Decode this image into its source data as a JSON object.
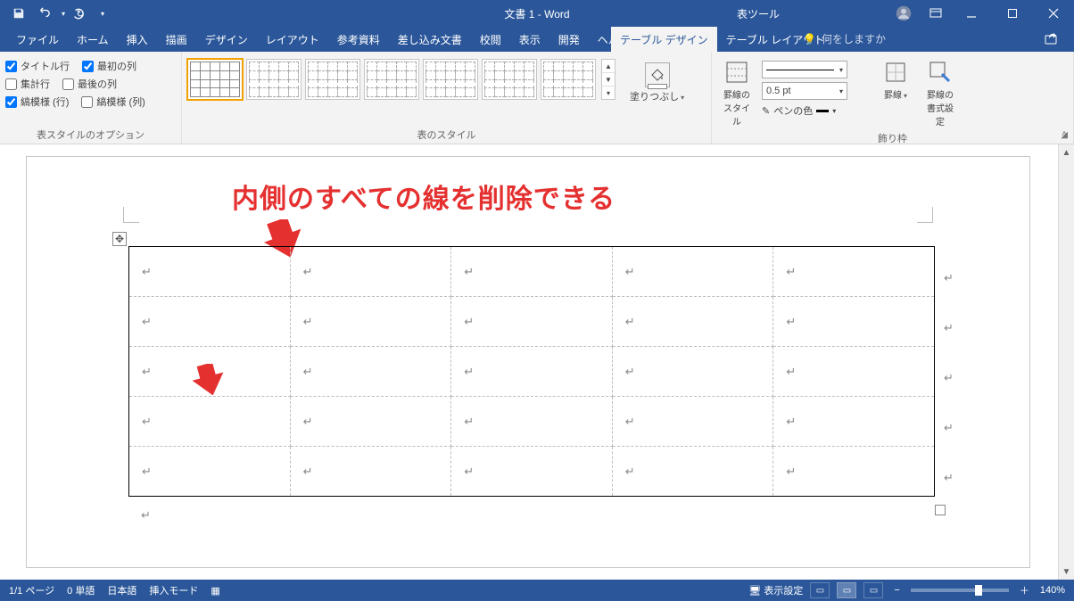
{
  "title": {
    "document": "文書 1",
    "app": "Word",
    "combined": "文書 1 - Word",
    "context_tool": "表ツール"
  },
  "tabs": {
    "file": "ファイル",
    "home": "ホーム",
    "insert": "挿入",
    "draw": "描画",
    "design": "デザイン",
    "layout": "レイアウト",
    "references": "参考資料",
    "mailings": "差し込み文書",
    "review": "校閲",
    "view": "表示",
    "developer": "開発",
    "help": "ヘルプ",
    "table_design": "テーブル デザイン",
    "table_layout": "テーブル レイアウト"
  },
  "tell_me": {
    "placeholder": "何をしますか"
  },
  "style_options": {
    "header_row": "タイトル行",
    "first_col": "最初の列",
    "total_row": "集計行",
    "last_col": "最後の列",
    "banded_rows": "縞模様 (行)",
    "banded_cols": "縞模様 (列)",
    "group_label": "表スタイルのオプション",
    "checked": {
      "header_row": true,
      "first_col": true,
      "total_row": false,
      "last_col": false,
      "banded_rows": true,
      "banded_cols": false
    }
  },
  "table_styles": {
    "group_label": "表のスタイル",
    "shading": "塗りつぶし"
  },
  "borders": {
    "group_label": "飾り枠",
    "border_styles": "罫線の\nスタイル",
    "pen_weight": "0.5 pt",
    "pen_color": "ペンの色",
    "borders_btn": "罫線",
    "format_btn": "罫線の\n書式設定"
  },
  "annotation": {
    "text": "内側のすべての線を削除できる"
  },
  "table": {
    "rows": 5,
    "cols": 5
  },
  "status": {
    "page": "1/1 ページ",
    "words": "0 単語",
    "lang": "日本語",
    "mode": "挿入モード",
    "display_settings": "表示設定",
    "zoom": "140%"
  }
}
